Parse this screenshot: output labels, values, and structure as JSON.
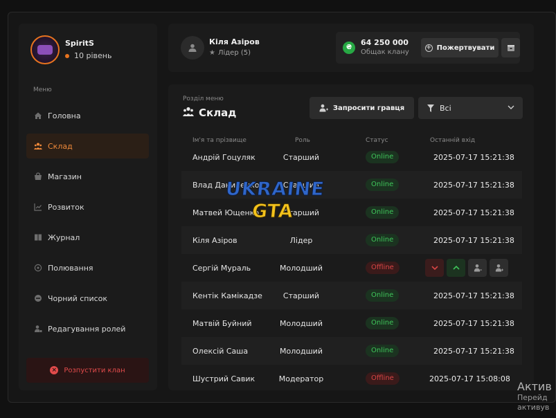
{
  "user": {
    "name": "SpiritS",
    "level": "10 рівень"
  },
  "menu": {
    "caption": "Меню",
    "items": [
      {
        "label": "Головна",
        "icon": "home-icon",
        "active": false
      },
      {
        "label": "Склад",
        "icon": "group-icon",
        "active": true
      },
      {
        "label": "Магазин",
        "icon": "shop-icon",
        "active": false
      },
      {
        "label": "Розвиток",
        "icon": "chart-icon",
        "active": false
      },
      {
        "label": "Журнал",
        "icon": "book-icon",
        "active": false
      },
      {
        "label": "Полювання",
        "icon": "target-icon",
        "active": false
      },
      {
        "label": "Чорний список",
        "icon": "block-icon",
        "active": false
      },
      {
        "label": "Редагування ролей",
        "icon": "user-edit-icon",
        "active": false
      }
    ],
    "disband_label": "Розпустити клан"
  },
  "header": {
    "leader_name": "Кіля Азіров",
    "leader_role": "Лідер (5)",
    "bank_amount": "64 250 000",
    "bank_label": "Общак клану",
    "donate_label": "Пожертвувати"
  },
  "section": {
    "caption": "Розділ меню",
    "title": "Склад",
    "invite_label": "Запросити гравця",
    "filter_value": "Всі"
  },
  "table": {
    "headers": {
      "name": "Ім'я та прізвище",
      "role": "Роль",
      "status": "Статус",
      "last": "Останній вхід"
    },
    "rows": [
      {
        "name": "Андрій Гоцуляк",
        "role": "Старший",
        "status": "Online",
        "last": "2025-07-17 15:21:38"
      },
      {
        "name": "Влад Даниленко",
        "role": "Старший",
        "status": "Online",
        "last": "2025-07-17 15:21:38"
      },
      {
        "name": "Матвей Ющенко",
        "role": "Старший",
        "status": "Online",
        "last": "2025-07-17 15:21:38"
      },
      {
        "name": "Кіля Азіров",
        "role": "Лідер",
        "status": "Online",
        "last": "2025-07-17 15:21:38"
      },
      {
        "name": "Сергій Мураль",
        "role": "Молодший",
        "status": "Offline",
        "last": ""
      },
      {
        "name": "Кентік Камікадзе",
        "role": "Старший",
        "status": "Online",
        "last": "2025-07-17 15:21:38"
      },
      {
        "name": "Матвій Буйний",
        "role": "Молодший",
        "status": "Online",
        "last": "2025-07-17 15:21:38"
      },
      {
        "name": "Олексій Саша",
        "role": "Молодший",
        "status": "Online",
        "last": "2025-07-17 15:21:38"
      },
      {
        "name": "Шустрий Савик",
        "role": "Модератор",
        "status": "Offline",
        "last": "2025-07-17 15:08:08"
      }
    ]
  },
  "watermark": {
    "line1": "UKRAINE",
    "line2": "GTA"
  },
  "os_notice": {
    "title": "Актив",
    "line1": "Перейд",
    "line2": "активув"
  },
  "colors": {
    "accent": "#e8731f",
    "online": "#3fc55a",
    "offline": "#d84545",
    "money": "#27a844"
  }
}
